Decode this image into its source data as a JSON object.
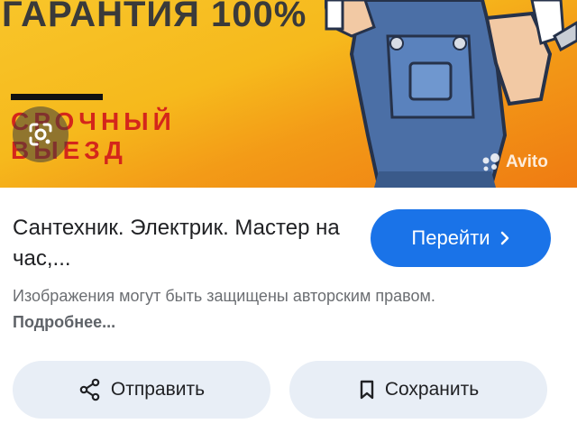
{
  "banner": {
    "headline": "ГАРАНТИЯ 100%",
    "urgent_line1": "СРОЧНЫЙ",
    "urgent_line2": "ВЫЕЗД",
    "watermark": "Avito"
  },
  "result": {
    "title": "Сантехник. Электрик. Мастер на час,...",
    "visit_label": "Перейти",
    "copyright_notice": "Изображения могут быть защищены авторским правом.",
    "more_link": "Подробнее..."
  },
  "actions": {
    "share_label": "Отправить",
    "save_label": "Сохранить"
  },
  "colors": {
    "accent": "#1a73e8",
    "action_bg": "#e8eef6",
    "banner_yellow": "#f8c52a",
    "banner_orange": "#ef7b12",
    "urgent_red": "#d4261b"
  },
  "icons": {
    "lens": "google-lens-icon",
    "share": "share-icon",
    "save": "bookmark-icon",
    "visit": "chevron-right-icon"
  }
}
